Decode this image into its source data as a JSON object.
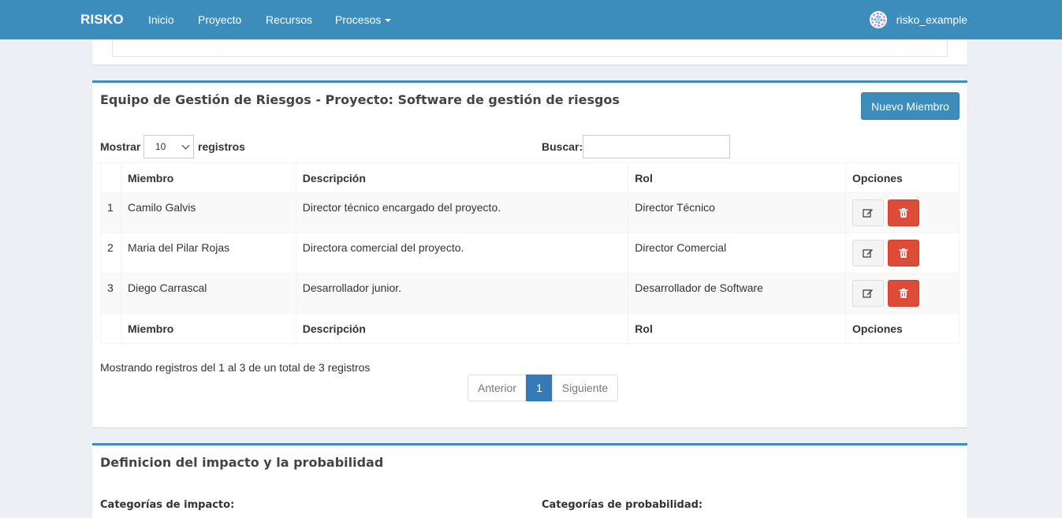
{
  "navbar": {
    "brand": "RISKO",
    "links": [
      "Inicio",
      "Proyecto",
      "Recursos",
      "Procesos"
    ],
    "user": "risko_example",
    "color": "#3c8dbc"
  },
  "team": {
    "title": "Equipo de Gestión de Riesgos - Proyecto: Software de gestión de riesgos",
    "new_button": "Nuevo Miembro",
    "length_prefix": "Mostrar",
    "length_value": "10",
    "length_suffix": "registros",
    "search_label": "Buscar:",
    "search_value": "",
    "columns": [
      "Miembro",
      "Descripción",
      "Rol",
      "Opciones"
    ],
    "rows": [
      {
        "n": "1",
        "member": "Camilo Galvis",
        "description": "Director técnico encargado del proyecto.",
        "role": "Director Técnico"
      },
      {
        "n": "2",
        "member": "Maria del Pilar Rojas",
        "description": "Directora comercial del proyecto.",
        "role": "Director Comercial"
      },
      {
        "n": "3",
        "member": "Diego Carrascal",
        "description": "Desarrollador junior.",
        "role": "Desarrollador de Software"
      }
    ],
    "info": "Mostrando registros del 1 al 3 de un total de 3 registros",
    "pagination": {
      "prev": "Anterior",
      "page": "1",
      "next": "Siguiente"
    }
  },
  "definition": {
    "title": "Definicion del impacto y la probabilidad",
    "impact_label": "Categorías de impacto:",
    "probability_label": "Categorías de probabilidad:"
  },
  "icons": {
    "edit": "edit-icon",
    "delete": "trash-icon",
    "avatar": "user-avatar-icon",
    "dropdown": "caret-down-icon"
  },
  "colors": {
    "primary": "#3c8dbc",
    "danger": "#dd4b39",
    "page_active": "#337ab7",
    "background": "#ecf0f5"
  }
}
